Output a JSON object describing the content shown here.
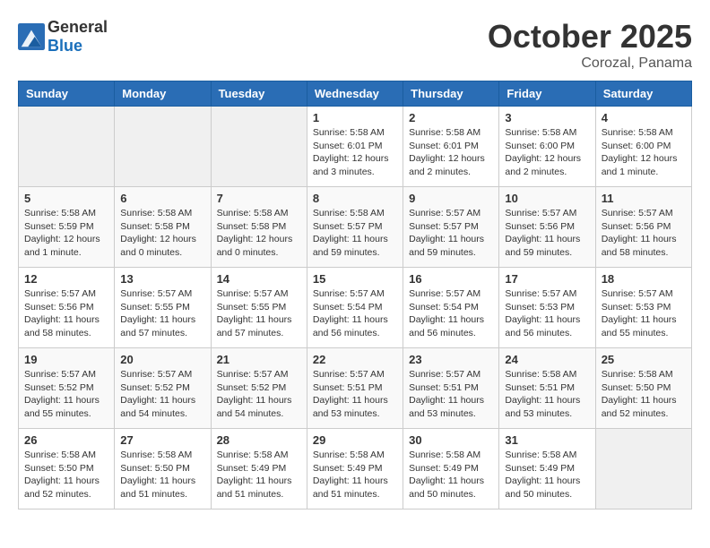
{
  "header": {
    "logo_general": "General",
    "logo_blue": "Blue",
    "month": "October 2025",
    "location": "Corozal, Panama"
  },
  "days_of_week": [
    "Sunday",
    "Monday",
    "Tuesday",
    "Wednesday",
    "Thursday",
    "Friday",
    "Saturday"
  ],
  "weeks": [
    [
      {
        "day": "",
        "info": ""
      },
      {
        "day": "",
        "info": ""
      },
      {
        "day": "",
        "info": ""
      },
      {
        "day": "1",
        "info": "Sunrise: 5:58 AM\nSunset: 6:01 PM\nDaylight: 12 hours and 3 minutes."
      },
      {
        "day": "2",
        "info": "Sunrise: 5:58 AM\nSunset: 6:01 PM\nDaylight: 12 hours and 2 minutes."
      },
      {
        "day": "3",
        "info": "Sunrise: 5:58 AM\nSunset: 6:00 PM\nDaylight: 12 hours and 2 minutes."
      },
      {
        "day": "4",
        "info": "Sunrise: 5:58 AM\nSunset: 6:00 PM\nDaylight: 12 hours and 1 minute."
      }
    ],
    [
      {
        "day": "5",
        "info": "Sunrise: 5:58 AM\nSunset: 5:59 PM\nDaylight: 12 hours and 1 minute."
      },
      {
        "day": "6",
        "info": "Sunrise: 5:58 AM\nSunset: 5:58 PM\nDaylight: 12 hours and 0 minutes."
      },
      {
        "day": "7",
        "info": "Sunrise: 5:58 AM\nSunset: 5:58 PM\nDaylight: 12 hours and 0 minutes."
      },
      {
        "day": "8",
        "info": "Sunrise: 5:58 AM\nSunset: 5:57 PM\nDaylight: 11 hours and 59 minutes."
      },
      {
        "day": "9",
        "info": "Sunrise: 5:57 AM\nSunset: 5:57 PM\nDaylight: 11 hours and 59 minutes."
      },
      {
        "day": "10",
        "info": "Sunrise: 5:57 AM\nSunset: 5:56 PM\nDaylight: 11 hours and 59 minutes."
      },
      {
        "day": "11",
        "info": "Sunrise: 5:57 AM\nSunset: 5:56 PM\nDaylight: 11 hours and 58 minutes."
      }
    ],
    [
      {
        "day": "12",
        "info": "Sunrise: 5:57 AM\nSunset: 5:56 PM\nDaylight: 11 hours and 58 minutes."
      },
      {
        "day": "13",
        "info": "Sunrise: 5:57 AM\nSunset: 5:55 PM\nDaylight: 11 hours and 57 minutes."
      },
      {
        "day": "14",
        "info": "Sunrise: 5:57 AM\nSunset: 5:55 PM\nDaylight: 11 hours and 57 minutes."
      },
      {
        "day": "15",
        "info": "Sunrise: 5:57 AM\nSunset: 5:54 PM\nDaylight: 11 hours and 56 minutes."
      },
      {
        "day": "16",
        "info": "Sunrise: 5:57 AM\nSunset: 5:54 PM\nDaylight: 11 hours and 56 minutes."
      },
      {
        "day": "17",
        "info": "Sunrise: 5:57 AM\nSunset: 5:53 PM\nDaylight: 11 hours and 56 minutes."
      },
      {
        "day": "18",
        "info": "Sunrise: 5:57 AM\nSunset: 5:53 PM\nDaylight: 11 hours and 55 minutes."
      }
    ],
    [
      {
        "day": "19",
        "info": "Sunrise: 5:57 AM\nSunset: 5:52 PM\nDaylight: 11 hours and 55 minutes."
      },
      {
        "day": "20",
        "info": "Sunrise: 5:57 AM\nSunset: 5:52 PM\nDaylight: 11 hours and 54 minutes."
      },
      {
        "day": "21",
        "info": "Sunrise: 5:57 AM\nSunset: 5:52 PM\nDaylight: 11 hours and 54 minutes."
      },
      {
        "day": "22",
        "info": "Sunrise: 5:57 AM\nSunset: 5:51 PM\nDaylight: 11 hours and 53 minutes."
      },
      {
        "day": "23",
        "info": "Sunrise: 5:57 AM\nSunset: 5:51 PM\nDaylight: 11 hours and 53 minutes."
      },
      {
        "day": "24",
        "info": "Sunrise: 5:58 AM\nSunset: 5:51 PM\nDaylight: 11 hours and 53 minutes."
      },
      {
        "day": "25",
        "info": "Sunrise: 5:58 AM\nSunset: 5:50 PM\nDaylight: 11 hours and 52 minutes."
      }
    ],
    [
      {
        "day": "26",
        "info": "Sunrise: 5:58 AM\nSunset: 5:50 PM\nDaylight: 11 hours and 52 minutes."
      },
      {
        "day": "27",
        "info": "Sunrise: 5:58 AM\nSunset: 5:50 PM\nDaylight: 11 hours and 51 minutes."
      },
      {
        "day": "28",
        "info": "Sunrise: 5:58 AM\nSunset: 5:49 PM\nDaylight: 11 hours and 51 minutes."
      },
      {
        "day": "29",
        "info": "Sunrise: 5:58 AM\nSunset: 5:49 PM\nDaylight: 11 hours and 51 minutes."
      },
      {
        "day": "30",
        "info": "Sunrise: 5:58 AM\nSunset: 5:49 PM\nDaylight: 11 hours and 50 minutes."
      },
      {
        "day": "31",
        "info": "Sunrise: 5:58 AM\nSunset: 5:49 PM\nDaylight: 11 hours and 50 minutes."
      },
      {
        "day": "",
        "info": ""
      }
    ]
  ]
}
